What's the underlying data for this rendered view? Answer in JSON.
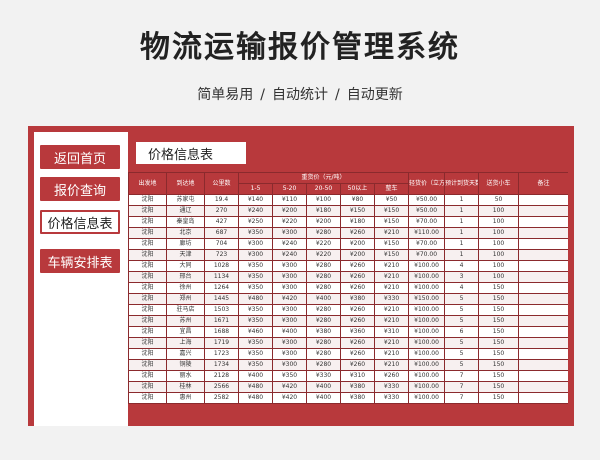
{
  "header": {
    "title": "物流运输报价管理系统",
    "subtitle": [
      "简单易用",
      "自动统计",
      "自动更新"
    ],
    "separator": "/"
  },
  "sidebar": {
    "items": [
      {
        "label": "返回首页",
        "active": false
      },
      {
        "label": "报价查询",
        "active": false
      },
      {
        "label": "价格信息表",
        "active": true
      },
      {
        "label": "车辆安排表",
        "active": false
      }
    ]
  },
  "tab_title": "价格信息表",
  "table": {
    "headers_top": [
      "出发地",
      "到达地",
      "公里数",
      "重货价（元/吨）",
      "轻货价（立方）",
      "预计到货天数",
      "送货小车",
      "备注"
    ],
    "headers_sub": [
      "1-5",
      "5-20",
      "20-50",
      "50以上",
      "整车"
    ],
    "rows": [
      [
        "沈阳",
        "苏家屯",
        "19.4",
        "¥140",
        "¥110",
        "¥100",
        "¥80",
        "¥50",
        "¥50.00",
        "1",
        "50",
        ""
      ],
      [
        "沈阳",
        "通辽",
        "270",
        "¥240",
        "¥200",
        "¥180",
        "¥150",
        "¥150",
        "¥50.00",
        "1",
        "100",
        ""
      ],
      [
        "沈阳",
        "秦皇岛",
        "427",
        "¥250",
        "¥220",
        "¥200",
        "¥180",
        "¥150",
        "¥70.00",
        "1",
        "100",
        ""
      ],
      [
        "沈阳",
        "北京",
        "687",
        "¥350",
        "¥300",
        "¥280",
        "¥260",
        "¥210",
        "¥110.00",
        "1",
        "100",
        ""
      ],
      [
        "沈阳",
        "廊坊",
        "704",
        "¥300",
        "¥240",
        "¥220",
        "¥200",
        "¥150",
        "¥70.00",
        "1",
        "100",
        ""
      ],
      [
        "沈阳",
        "天津",
        "723",
        "¥300",
        "¥240",
        "¥220",
        "¥200",
        "¥150",
        "¥70.00",
        "1",
        "100",
        ""
      ],
      [
        "沈阳",
        "大同",
        "1028",
        "¥350",
        "¥300",
        "¥280",
        "¥260",
        "¥210",
        "¥100.00",
        "4",
        "100",
        ""
      ],
      [
        "沈阳",
        "邢台",
        "1134",
        "¥350",
        "¥300",
        "¥280",
        "¥260",
        "¥210",
        "¥100.00",
        "3",
        "100",
        ""
      ],
      [
        "沈阳",
        "徐州",
        "1264",
        "¥350",
        "¥300",
        "¥280",
        "¥260",
        "¥210",
        "¥100.00",
        "4",
        "150",
        ""
      ],
      [
        "沈阳",
        "郑州",
        "1445",
        "¥480",
        "¥420",
        "¥400",
        "¥380",
        "¥330",
        "¥150.00",
        "5",
        "150",
        ""
      ],
      [
        "沈阳",
        "驻马店",
        "1503",
        "¥350",
        "¥300",
        "¥280",
        "¥260",
        "¥210",
        "¥100.00",
        "5",
        "150",
        ""
      ],
      [
        "沈阳",
        "苏州",
        "1671",
        "¥350",
        "¥300",
        "¥280",
        "¥260",
        "¥210",
        "¥100.00",
        "5",
        "150",
        ""
      ],
      [
        "沈阳",
        "宜昌",
        "1688",
        "¥460",
        "¥400",
        "¥380",
        "¥360",
        "¥310",
        "¥100.00",
        "6",
        "150",
        ""
      ],
      [
        "沈阳",
        "上海",
        "1719",
        "¥350",
        "¥300",
        "¥280",
        "¥260",
        "¥210",
        "¥100.00",
        "5",
        "150",
        ""
      ],
      [
        "沈阳",
        "嘉兴",
        "1723",
        "¥350",
        "¥300",
        "¥280",
        "¥260",
        "¥210",
        "¥100.00",
        "5",
        "150",
        ""
      ],
      [
        "沈阳",
        "铜陵",
        "1734",
        "¥350",
        "¥300",
        "¥280",
        "¥260",
        "¥210",
        "¥100.00",
        "5",
        "150",
        ""
      ],
      [
        "沈阳",
        "丽水",
        "2128",
        "¥400",
        "¥350",
        "¥330",
        "¥310",
        "¥260",
        "¥100.00",
        "7",
        "150",
        ""
      ],
      [
        "沈阳",
        "桂林",
        "2566",
        "¥480",
        "¥420",
        "¥400",
        "¥380",
        "¥330",
        "¥100.00",
        "7",
        "150",
        ""
      ],
      [
        "沈阳",
        "惠州",
        "2582",
        "¥480",
        "¥420",
        "¥400",
        "¥380",
        "¥330",
        "¥100.00",
        "7",
        "150",
        ""
      ]
    ]
  },
  "colors": {
    "accent": "#b8393c",
    "background": "#f2f2f2"
  }
}
